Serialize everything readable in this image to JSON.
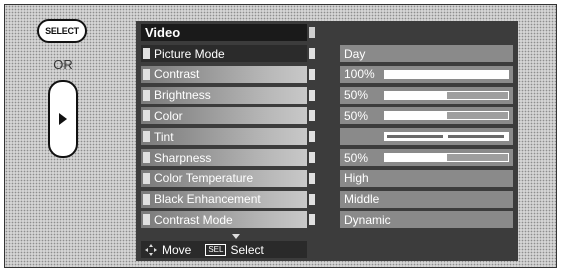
{
  "side": {
    "select_button_label": "SELECT",
    "or_label": "OR",
    "right_button_icon": "play-right-icon"
  },
  "menu": {
    "title": "Video",
    "items": [
      {
        "label": "Picture Mode",
        "value": "Day",
        "selected": true
      },
      {
        "label": "Contrast",
        "value": "100%",
        "level": 1.0
      },
      {
        "label": "Brightness",
        "value": "50%",
        "level": 0.5
      },
      {
        "label": "Color",
        "value": "50%",
        "level": 0.5
      },
      {
        "label": "Tint",
        "value": "",
        "tint": 0.5
      },
      {
        "label": "Sharpness",
        "value": "50%",
        "level": 0.5
      },
      {
        "label": "Color Temperature",
        "value": "High"
      },
      {
        "label": "Black Enhancement",
        "value": "Middle"
      },
      {
        "label": "Contrast Mode",
        "value": "Dynamic"
      }
    ],
    "more_below_icon": "triangle-down-icon",
    "footer": {
      "move_icon": "arrow-cross-icon",
      "move_label": "Move",
      "select_chip": "SEL",
      "select_label": "Select"
    }
  },
  "colors": {
    "panel": "#3c3c3c",
    "value_bg": "#8a8a8a",
    "highlight": "#2b2b2b"
  }
}
